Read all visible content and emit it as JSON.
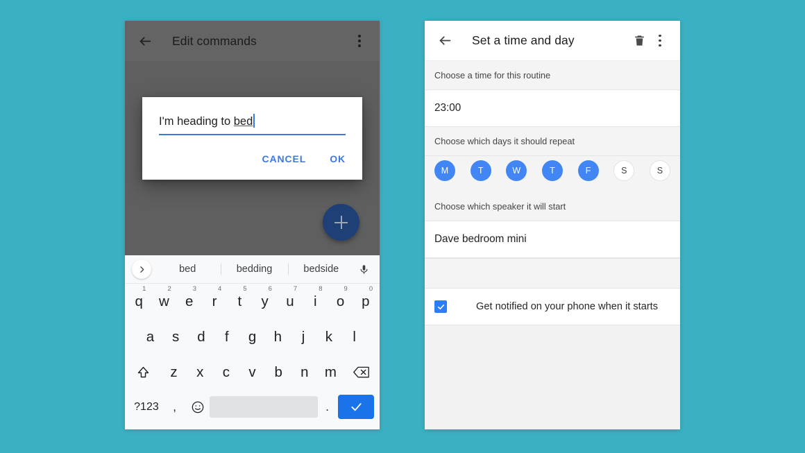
{
  "theme": {
    "background": "#3BB0C2",
    "accent_blue": "#4285f4",
    "dialog_blue": "#3b78e7",
    "enter_blue": "#1a73e8",
    "fab_blue": "#1f3f77",
    "app_scrim_gray": "#5f5f5f"
  },
  "left_phone": {
    "appbar": {
      "back_icon": "arrow-left-icon",
      "title": "Edit commands",
      "overflow_icon": "more-vert-icon"
    },
    "fab": {
      "icon": "plus-icon",
      "label": "+"
    },
    "dialog": {
      "input_value_prefix": "I'm heading to ",
      "input_composing": "bed",
      "cancel_label": "CANCEL",
      "ok_label": "OK"
    },
    "keyboard": {
      "expand_icon": "chevron-right-icon",
      "mic_icon": "microphone-icon",
      "suggestions": [
        "bed",
        "bedding",
        "bedside"
      ],
      "row1": [
        {
          "key": "q",
          "num": "1"
        },
        {
          "key": "w",
          "num": "2"
        },
        {
          "key": "e",
          "num": "3"
        },
        {
          "key": "r",
          "num": "4"
        },
        {
          "key": "t",
          "num": "5"
        },
        {
          "key": "y",
          "num": "6"
        },
        {
          "key": "u",
          "num": "7"
        },
        {
          "key": "i",
          "num": "8"
        },
        {
          "key": "o",
          "num": "9"
        },
        {
          "key": "p",
          "num": "0"
        }
      ],
      "row2": [
        "a",
        "s",
        "d",
        "f",
        "g",
        "h",
        "j",
        "k",
        "l"
      ],
      "row3": [
        "z",
        "x",
        "c",
        "v",
        "b",
        "n",
        "m"
      ],
      "shift_icon": "shift-icon",
      "backspace_icon": "backspace-icon",
      "row4": {
        "symbols_label": "?123",
        "comma_label": ",",
        "emoji_icon": "emoji-smiley-icon",
        "space_label": "",
        "period_label": ".",
        "enter_icon": "checkmark-icon"
      }
    }
  },
  "right_phone": {
    "appbar": {
      "back_icon": "arrow-left-icon",
      "title": "Set a time and day",
      "delete_icon": "trash-icon",
      "overflow_icon": "more-vert-icon"
    },
    "time_section": {
      "header": "Choose a time for this routine",
      "value": "23:00"
    },
    "days_section": {
      "header": "Choose which days it should repeat",
      "days": [
        {
          "label": "M",
          "selected": true
        },
        {
          "label": "T",
          "selected": true
        },
        {
          "label": "W",
          "selected": true
        },
        {
          "label": "T",
          "selected": true
        },
        {
          "label": "F",
          "selected": true
        },
        {
          "label": "S",
          "selected": false
        },
        {
          "label": "S",
          "selected": false
        }
      ]
    },
    "speaker_section": {
      "header": "Choose which speaker it will start",
      "value": "Dave bedroom mini"
    },
    "notify": {
      "checked": true,
      "label": "Get notified on your phone when it starts"
    }
  }
}
